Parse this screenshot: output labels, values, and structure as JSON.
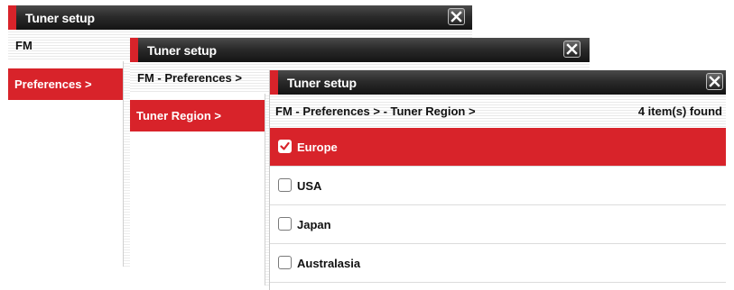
{
  "colors": {
    "accent": "#d8232a",
    "titlebar": "#1e1e1e"
  },
  "window1": {
    "title": "Tuner setup",
    "path": "FM",
    "menu_item": "Preferences >"
  },
  "window2": {
    "title": "Tuner setup",
    "path": "FM - Preferences >",
    "menu_item": "Tuner Region >"
  },
  "window3": {
    "title": "Tuner setup",
    "path": "FM - Preferences > - Tuner Region >",
    "found": "4 item(s) found",
    "items": [
      {
        "label": "Europe",
        "checked": true
      },
      {
        "label": "USA",
        "checked": false
      },
      {
        "label": "Japan",
        "checked": false
      },
      {
        "label": "Australasia",
        "checked": false
      }
    ]
  },
  "icons": {
    "close": "close-icon",
    "check": "checkmark-icon"
  }
}
